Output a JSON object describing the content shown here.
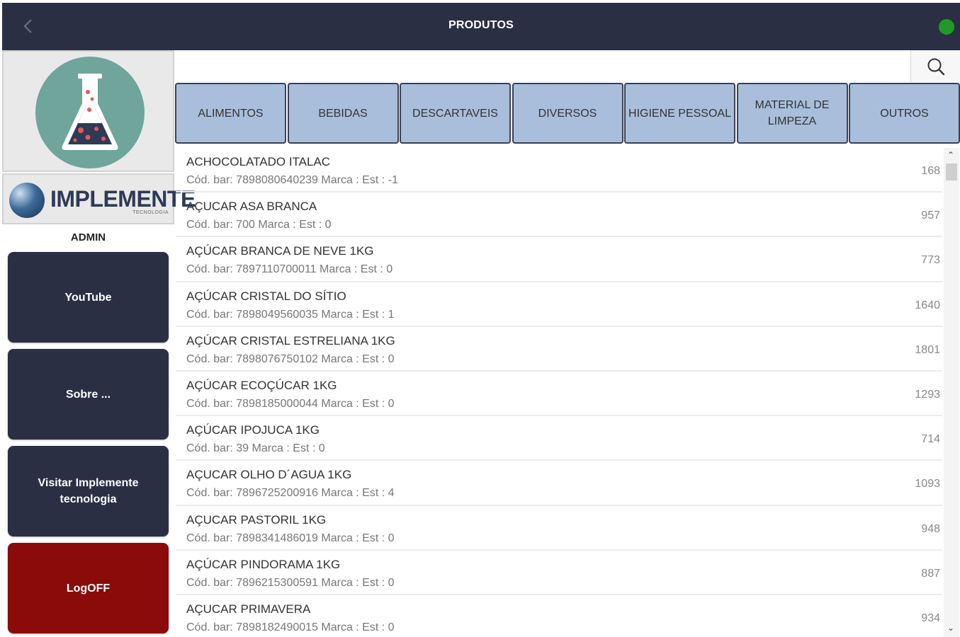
{
  "header": {
    "title": "PRODUTOS",
    "back_icon": "chevron-left-icon",
    "status_color": "#1f9b25"
  },
  "sidebar": {
    "brand_name": "IMPLEMENTE",
    "brand_sub": "TECNOLOGIA",
    "user": "ADMIN",
    "buttons": [
      {
        "label": "YouTube"
      },
      {
        "label": "Sobre ..."
      },
      {
        "label": "Visitar Implemente tecnologia"
      },
      {
        "label": "LogOFF"
      }
    ]
  },
  "search": {
    "value": "",
    "placeholder": "",
    "icon": "search-icon"
  },
  "categories": [
    {
      "label": "ALIMENTOS"
    },
    {
      "label": "BEBIDAS"
    },
    {
      "label": "DESCARTAVEIS"
    },
    {
      "label": "DIVERSOS"
    },
    {
      "label": "HIGIENE PESSOAL"
    },
    {
      "label": "MATERIAL DE LIMPEZA"
    },
    {
      "label": "OUTROS"
    }
  ],
  "products": [
    {
      "name": "ACHOCOLATADO ITALAC",
      "detail": "Cód. bar: 7898080640239 Marca :  Est : -1",
      "code": "168"
    },
    {
      "name": "AÇUCAR ASA BRANCA",
      "detail": "Cód. bar: 700 Marca :  Est : 0",
      "code": "957"
    },
    {
      "name": "AÇÚCAR BRANCA DE NEVE 1KG",
      "detail": "Cód. bar: 7897110700011 Marca :  Est : 0",
      "code": "773"
    },
    {
      "name": "AÇÚCAR CRISTAL DO SÍTIO",
      "detail": "Cód. bar: 7898049560035 Marca :  Est : 1",
      "code": "1640"
    },
    {
      "name": "AÇÚCAR CRISTAL ESTRELIANA 1KG",
      "detail": "Cód. bar: 7898076750102 Marca :  Est : 0",
      "code": "1801"
    },
    {
      "name": "AÇÚCAR ECOÇÚCAR 1KG",
      "detail": "Cód. bar: 7898185000044 Marca :  Est : 0",
      "code": "1293"
    },
    {
      "name": "AÇÚCAR IPOJUCA 1KG",
      "detail": "Cód. bar: 39 Marca :  Est : 0",
      "code": "714"
    },
    {
      "name": "AÇUCAR OLHO D´AGUA 1KG",
      "detail": "Cód. bar: 7896725200916 Marca :  Est : 4",
      "code": "1093"
    },
    {
      "name": "AÇUCAR PASTORIL 1KG",
      "detail": "Cód. bar: 7898341486019 Marca :  Est : 0",
      "code": "948"
    },
    {
      "name": "AÇÚCAR PINDORAMA 1KG",
      "detail": "Cód. bar: 7896215300591 Marca :  Est : 0",
      "code": "887"
    },
    {
      "name": "AÇUCAR PRIMAVERA",
      "detail": "Cód. bar: 7898182490015 Marca :  Est : 0",
      "code": "934"
    }
  ],
  "colors": {
    "header_bg": "#2b2f44",
    "category_bg": "#a9bedb",
    "logoff_bg": "#8b0a0a"
  }
}
